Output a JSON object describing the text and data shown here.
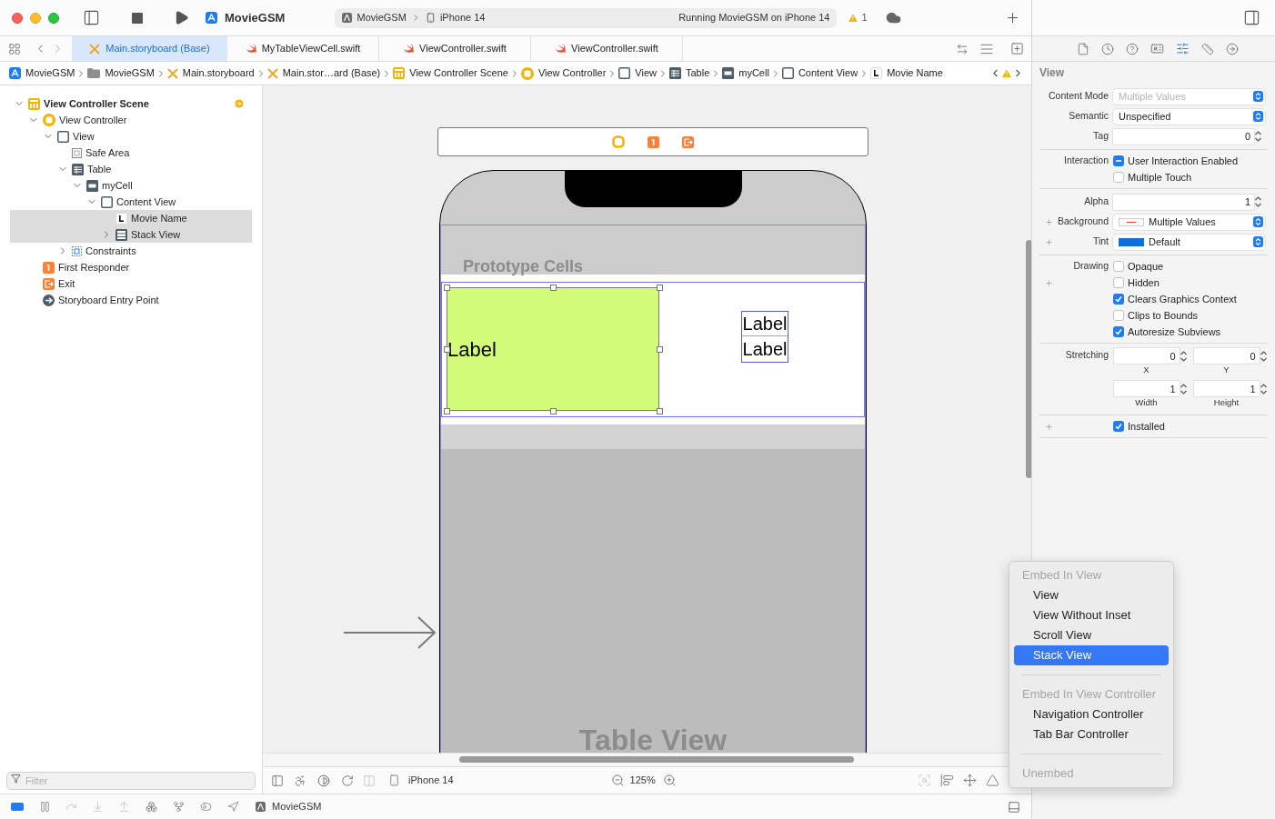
{
  "toolbar": {
    "project": "MovieGSM",
    "scheme": "MovieGSM",
    "device": "iPhone 14",
    "status": "Running MovieGSM on iPhone 14",
    "warnings": "1"
  },
  "tabs": [
    {
      "label": "Main.storyboard (Base)",
      "kind": "storyboard",
      "selected": true
    },
    {
      "label": "MyTableViewCell.swift",
      "kind": "swift",
      "selected": false
    },
    {
      "label": "ViewController.swift",
      "kind": "swift",
      "selected": false
    },
    {
      "label": "ViewController.swift",
      "kind": "swift",
      "selected": false
    }
  ],
  "breadcrumb": [
    {
      "label": "MovieGSM",
      "kind": "app"
    },
    {
      "label": "MovieGSM",
      "kind": "folder"
    },
    {
      "label": "Main.storyboard",
      "kind": "storyboard"
    },
    {
      "label": "Main.stor…ard (Base)",
      "kind": "storyboard"
    },
    {
      "label": "View Controller Scene",
      "kind": "scene"
    },
    {
      "label": "View Controller",
      "kind": "controller"
    },
    {
      "label": "View",
      "kind": "view"
    },
    {
      "label": "Table",
      "kind": "table"
    },
    {
      "label": "myCell",
      "kind": "cell"
    },
    {
      "label": "Content View",
      "kind": "view"
    },
    {
      "label": "Movie Name",
      "kind": "label"
    }
  ],
  "navigator": {
    "tree": [
      {
        "label": "View Controller Scene",
        "kind": "scene",
        "expanded": true,
        "selected": false,
        "children": [
          {
            "label": "View Controller",
            "kind": "controller",
            "expanded": true,
            "selected": false,
            "children": [
              {
                "label": "View",
                "kind": "view",
                "expanded": true,
                "selected": false,
                "children": [
                  {
                    "label": "Safe Area",
                    "kind": "safe_area",
                    "selected": false
                  },
                  {
                    "label": "Table",
                    "kind": "table",
                    "expanded": true,
                    "selected": false,
                    "children": [
                      {
                        "label": "myCell",
                        "kind": "cell",
                        "expanded": true,
                        "selected": false,
                        "children": [
                          {
                            "label": "Content View",
                            "kind": "view",
                            "expanded": true,
                            "selected": false,
                            "children": [
                              {
                                "label": "Movie Name",
                                "kind": "label",
                                "selected": true
                              },
                              {
                                "label": "Stack View",
                                "kind": "stack",
                                "expanded": false,
                                "selected": true
                              }
                            ]
                          }
                        ]
                      }
                    ]
                  },
                  {
                    "label": "Constraints",
                    "kind": "constraints",
                    "expanded": false,
                    "selected": false
                  }
                ]
              }
            ]
          },
          {
            "label": "First Responder",
            "kind": "responder",
            "selected": false
          },
          {
            "label": "Exit",
            "kind": "exit",
            "selected": false
          },
          {
            "label": "Storyboard Entry Point",
            "kind": "entry",
            "selected": false
          }
        ]
      }
    ],
    "filter": {
      "placeholder": "Filter"
    }
  },
  "canvas": {
    "prototype_title": "Prototype Cells",
    "cell_label": "Label",
    "stack_labels": [
      "Label",
      "Label"
    ],
    "table_title": "Table View"
  },
  "canvas_bar": {
    "device": "iPhone 14",
    "zoom": "125%"
  },
  "debug_bar": {
    "breakpoints_active": true,
    "process": "MovieGSM"
  },
  "inspector": {
    "title": "View",
    "groups": [
      {
        "rows": [
          {
            "kind": "popup",
            "label": "Content Mode",
            "value": "Multiple Values",
            "dimmed": true,
            "plus": false
          },
          {
            "kind": "popup",
            "label": "Semantic",
            "value": "Unspecified",
            "dimmed": false,
            "plus": false
          },
          {
            "kind": "stepper",
            "label": "Tag",
            "value": "0",
            "plus": false
          }
        ]
      },
      {
        "rows": [
          {
            "kind": "checkbox",
            "label": "Interaction",
            "text": "User Interaction Enabled",
            "mixed": true,
            "plus": false
          },
          {
            "kind": "checkbox",
            "text": "Multiple Touch",
            "checked": false,
            "mixed": false,
            "plus": false
          }
        ]
      },
      {
        "rows": [
          {
            "kind": "stepper",
            "label": "Alpha",
            "value": "1",
            "plus": false
          },
          {
            "kind": "color",
            "label": "Background",
            "value": "Multiple Values",
            "mixed": true,
            "plus": true
          },
          {
            "kind": "color",
            "label": "Tint",
            "value": "Default",
            "mixed": false,
            "color": "#0f6fd8",
            "plus": true
          }
        ]
      },
      {
        "rows": [
          {
            "kind": "checkbox",
            "label": "Drawing",
            "text": "Opaque",
            "checked": false,
            "mixed": false,
            "plus": false
          },
          {
            "kind": "checkbox",
            "text": "Hidden",
            "checked": false,
            "mixed": false,
            "plus": true
          },
          {
            "kind": "checkbox",
            "text": "Clears Graphics Context",
            "checked": true,
            "mixed": false,
            "plus": false
          },
          {
            "kind": "checkbox",
            "text": "Clips to Bounds",
            "checked": false,
            "mixed": false,
            "plus": false
          },
          {
            "kind": "checkbox",
            "text": "Autoresize Subviews",
            "checked": true,
            "mixed": false,
            "plus": false
          }
        ]
      },
      {
        "rows": [
          {
            "kind": "pair",
            "label": "Stretching",
            "fields": [
              {
                "value": "0",
                "caption": "X"
              },
              {
                "value": "0",
                "caption": "Y"
              }
            ],
            "plus": false
          },
          {
            "kind": "pair",
            "fields": [
              {
                "value": "1",
                "caption": "Width"
              },
              {
                "value": "1",
                "caption": "Height"
              }
            ],
            "plus": false
          }
        ]
      },
      {
        "rows": [
          {
            "kind": "checkbox",
            "text": "Installed",
            "checked": true,
            "mixed": false,
            "plus": true
          }
        ]
      }
    ]
  },
  "embed_menu": [
    {
      "kind": "header",
      "label": "Embed In View"
    },
    {
      "kind": "item",
      "label": "View",
      "selected": false
    },
    {
      "kind": "item",
      "label": "View Without Inset",
      "selected": false
    },
    {
      "kind": "item",
      "label": "Scroll View",
      "selected": false
    },
    {
      "kind": "item",
      "label": "Stack View",
      "selected": true
    },
    {
      "kind": "separator"
    },
    {
      "kind": "header",
      "label": "Embed In View Controller"
    },
    {
      "kind": "item",
      "label": "Navigation Controller",
      "selected": false
    },
    {
      "kind": "item",
      "label": "Tab Bar Controller",
      "selected": false
    },
    {
      "kind": "separator"
    },
    {
      "kind": "header",
      "label": "Unembed"
    }
  ]
}
